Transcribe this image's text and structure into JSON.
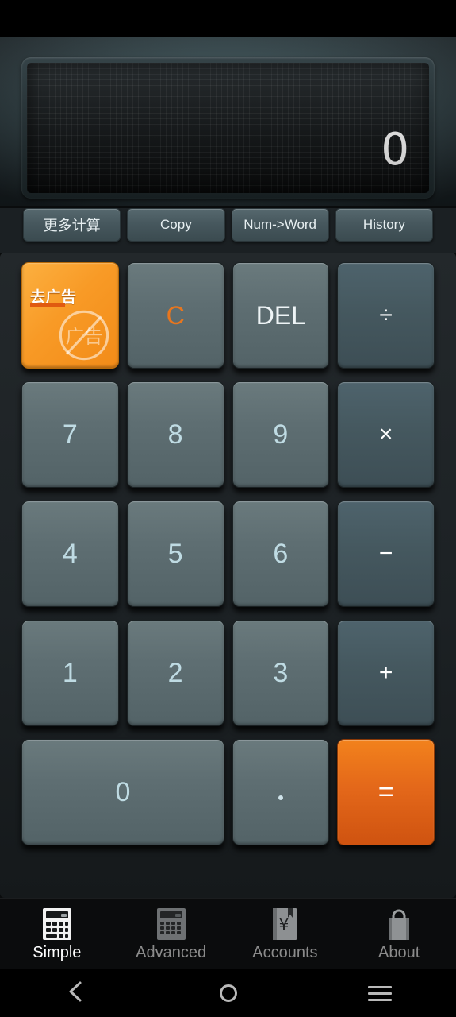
{
  "app": {
    "name": "Calculator",
    "active_tab": "Simple"
  },
  "display": {
    "value": "0",
    "align": "right"
  },
  "toolbar": {
    "buttons": [
      {
        "label": "更多计算",
        "name": "more-calculations-button"
      },
      {
        "label": "Copy",
        "name": "copy-button"
      },
      {
        "label": "Num->Word",
        "name": "num-to-word-button"
      },
      {
        "label": "History",
        "name": "history-button"
      }
    ]
  },
  "ad_button": {
    "label": "去广告",
    "badge_text": "广告",
    "icon": "no-ads-icon"
  },
  "keypad": {
    "rows": [
      [
        {
          "label": "去广告",
          "name": "remove-ads-button",
          "kind": "ad"
        },
        {
          "label": "C",
          "name": "clear-button",
          "kind": "clear"
        },
        {
          "label": "DEL",
          "name": "delete-button",
          "kind": "del"
        },
        {
          "label": "÷",
          "name": "divide-button",
          "kind": "op"
        }
      ],
      [
        {
          "label": "7",
          "name": "digit-7-button",
          "kind": "num"
        },
        {
          "label": "8",
          "name": "digit-8-button",
          "kind": "num"
        },
        {
          "label": "9",
          "name": "digit-9-button",
          "kind": "num"
        },
        {
          "label": "×",
          "name": "multiply-button",
          "kind": "op"
        }
      ],
      [
        {
          "label": "4",
          "name": "digit-4-button",
          "kind": "num"
        },
        {
          "label": "5",
          "name": "digit-5-button",
          "kind": "num"
        },
        {
          "label": "6",
          "name": "digit-6-button",
          "kind": "num"
        },
        {
          "label": "−",
          "name": "subtract-button",
          "kind": "op"
        }
      ],
      [
        {
          "label": "1",
          "name": "digit-1-button",
          "kind": "num"
        },
        {
          "label": "2",
          "name": "digit-2-button",
          "kind": "num"
        },
        {
          "label": "3",
          "name": "digit-3-button",
          "kind": "num"
        },
        {
          "label": "+",
          "name": "add-button",
          "kind": "op"
        }
      ],
      [
        {
          "label": "0",
          "name": "digit-0-button",
          "kind": "num-wide"
        },
        {
          "label": ".",
          "name": "decimal-point-button",
          "kind": "dot"
        },
        {
          "label": "=",
          "name": "equals-button",
          "kind": "equals"
        }
      ]
    ]
  },
  "tabs": [
    {
      "label": "Simple",
      "name": "tab-simple",
      "icon": "calculator-icon",
      "active": true
    },
    {
      "label": "Advanced",
      "name": "tab-advanced",
      "icon": "calculator-advanced-icon",
      "active": false
    },
    {
      "label": "Accounts",
      "name": "tab-accounts",
      "icon": "ledger-yen-icon",
      "active": false
    },
    {
      "label": "About",
      "name": "tab-about",
      "icon": "shopping-bag-icon",
      "active": false
    }
  ],
  "system_nav": [
    {
      "name": "nav-back-button",
      "icon": "chevron-left-icon"
    },
    {
      "name": "nav-home-button",
      "icon": "circle-icon"
    },
    {
      "name": "nav-menu-button",
      "icon": "hamburger-menu-icon"
    }
  ],
  "colors": {
    "accent_orange": "#e4681a",
    "ad_orange": "#f89a26",
    "key_face": "#5e6e72",
    "op_face": "#45585f",
    "digit_text": "#bfdbe3",
    "display_text": "#ffffff",
    "panel_bg": "#1c2124"
  }
}
